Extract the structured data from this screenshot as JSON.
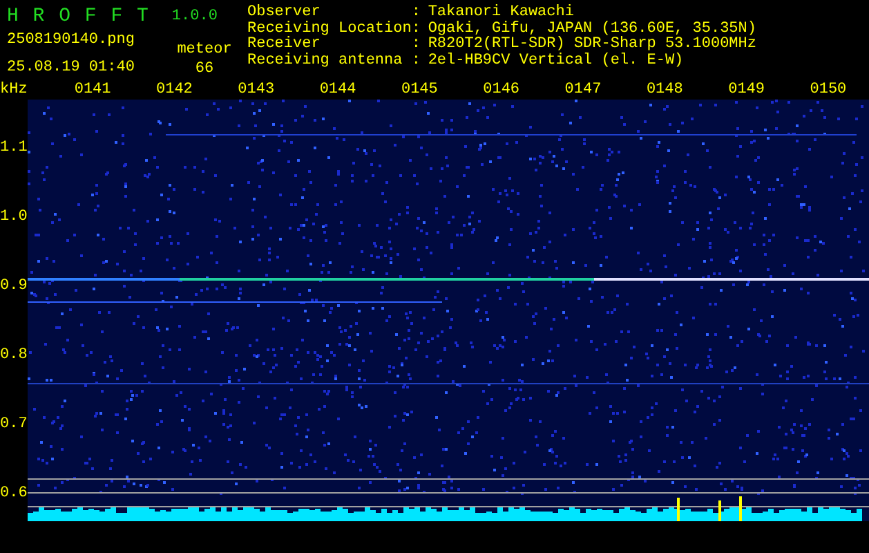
{
  "header": {
    "title": "H R O F F T",
    "version": "1.0.0",
    "file": "2508190140.png",
    "datetime": "25.08.19 01:40",
    "meteor_label": "meteor",
    "meteor_count": "66",
    "info": [
      {
        "label": "Observer",
        "separator": ":",
        "value": "Takanori Kawachi"
      },
      {
        "label": "Receiving Location",
        "separator": ":",
        "value": "Ogaki, Gifu, JAPAN (136.60E, 35.35N)"
      },
      {
        "label": "Receiver",
        "separator": ":",
        "value": "R820T2(RTL-SDR) SDR-Sharp 53.1000MHz"
      },
      {
        "label": "Receiving antenna",
        "separator": ":",
        "value": "2el-HB9CV Vertical (el. E-W)"
      }
    ]
  },
  "spectrogram": {
    "unit": "kHz",
    "time_labels": [
      "0141",
      "0142",
      "0143",
      "0144",
      "0145",
      "0146",
      "0147",
      "0148",
      "0149",
      "0150"
    ],
    "freq_labels": [
      "1.1",
      "1.0",
      "0.9",
      "0.8",
      "0.7",
      "0.6"
    ]
  }
}
